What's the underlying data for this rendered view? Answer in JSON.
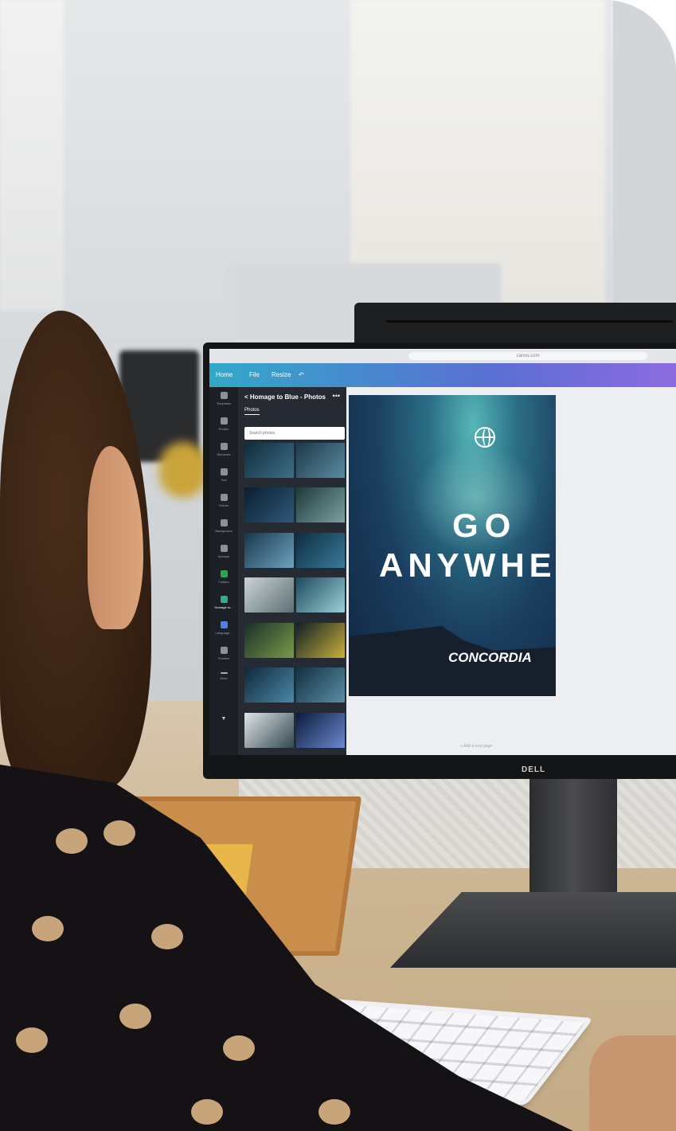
{
  "browser": {
    "url": "canva.com"
  },
  "app": {
    "nav": {
      "home": "Home",
      "file": "File",
      "resize": "Resize",
      "undo_icon": "undo-icon"
    },
    "rail": [
      {
        "label": "Templates"
      },
      {
        "label": "Photos"
      },
      {
        "label": "Elements"
      },
      {
        "label": "Text"
      },
      {
        "label": "Videos"
      },
      {
        "label": "Background"
      },
      {
        "label": "Uploads"
      },
      {
        "label": "Folders"
      },
      {
        "label": "Homage to..."
      },
      {
        "label": "Language..."
      },
      {
        "label": "Position"
      },
      {
        "label": "More"
      }
    ],
    "panel": {
      "title": "< Homage to Blue - Photos",
      "menu": "•••",
      "tab": "Photos",
      "search_placeholder": "Search photos"
    },
    "poster": {
      "line1": "GO",
      "line2": "ANYWHE",
      "brand": "CONCORDIA"
    },
    "add_page": "+ Add a new page"
  },
  "monitor_brand": "DELL",
  "colors": {
    "appbar_start": "#31a9c9",
    "appbar_end": "#8e6be0",
    "panel_bg": "#262a33",
    "rail_bg": "#1c1f26",
    "poster_bg": "#1b3f60"
  }
}
